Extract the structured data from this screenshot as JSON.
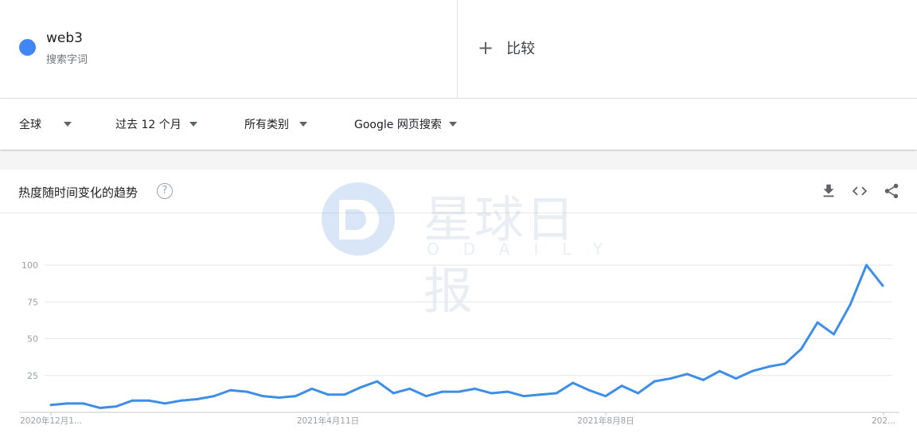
{
  "search_term": {
    "name": "web3",
    "type": "搜索字词",
    "color": "#4285f4"
  },
  "compare": {
    "label": "比较"
  },
  "filters": {
    "region": "全球",
    "time": "过去 12 个月",
    "category": "所有类别",
    "source": "Google 网页搜索"
  },
  "panel": {
    "title": "热度随时间变化的趋势",
    "help_glyph": "?"
  },
  "watermark": {
    "cn": "星球日报",
    "en": "ODAILY"
  },
  "chart_data": {
    "type": "line",
    "title": "热度随时间变化的趋势",
    "ylim": [
      0,
      100
    ],
    "y_ticks": [
      25,
      50,
      75,
      100
    ],
    "x_tick_labels": [
      "2020年12月1...",
      "2021年4月11日",
      "2021年8月8日",
      "202..."
    ],
    "grid": true,
    "series": [
      {
        "name": "web3",
        "color": "#3d8ee8",
        "values": [
          5,
          6,
          6,
          3,
          4,
          8,
          8,
          6,
          8,
          9,
          11,
          15,
          14,
          11,
          10,
          11,
          16,
          12,
          12,
          17,
          21,
          13,
          16,
          11,
          14,
          14,
          16,
          13,
          14,
          11,
          12,
          13,
          20,
          15,
          11,
          18,
          13,
          21,
          23,
          26,
          22,
          28,
          23,
          28,
          31,
          33,
          43,
          61,
          53,
          73,
          100,
          86
        ]
      }
    ]
  }
}
